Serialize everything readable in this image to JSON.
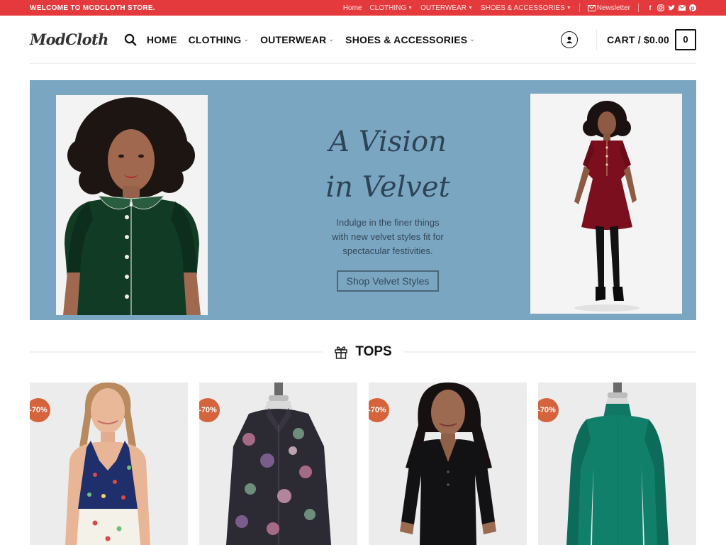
{
  "topbar": {
    "welcome": "WELCOME TO MODCLOTH STORE.",
    "links": [
      "Home",
      "CLOTHING",
      "OUTERWEAR",
      "SHOES & ACCESSORIES"
    ],
    "newsletter": "Newsletter",
    "social_icons": [
      "facebook-icon",
      "instagram-icon",
      "twitter-icon",
      "email-icon",
      "pinterest-icon"
    ]
  },
  "header": {
    "logo": "ModCloth",
    "nav": [
      "HOME",
      "CLOTHING",
      "OUTERWEAR",
      "SHOES & ACCESSORIES"
    ],
    "cart_label": "CART / $0.00",
    "cart_count": "0"
  },
  "hero": {
    "title_line1": "A Vision",
    "title_line2": "in Velvet",
    "subtitle_line1": "Indulge in the finer things",
    "subtitle_line2": "with new velvet styles fit for",
    "subtitle_line3": "spectacular festivities.",
    "button": "Shop Velvet Styles"
  },
  "section": {
    "title": "TOPS",
    "icon": "gift-icon"
  },
  "products": [
    {
      "badge": "-70%"
    },
    {
      "badge": "-70%"
    },
    {
      "badge": "-70%"
    },
    {
      "badge": "-70%"
    }
  ],
  "colors": {
    "topbar": "#e43a3d",
    "hero_bg": "#7ba6c1",
    "badge": "#d5633b",
    "text_dark": "#111111"
  }
}
